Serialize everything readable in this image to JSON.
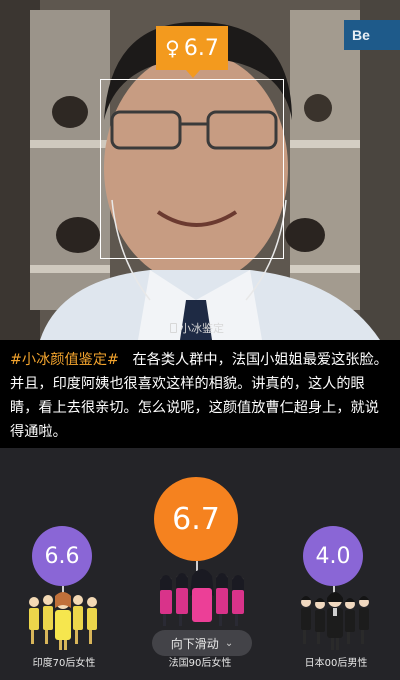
{
  "photo": {
    "score_symbol": "♀",
    "score": "6.7",
    "corner_text": "Be",
    "watermark": "小冰鉴定"
  },
  "caption": {
    "hashtag": "#小冰颜值鉴定#",
    "body": "在各类人群中，法国小姐姐最爱这张脸。并且，印度阿姨也很喜欢这样的相貌。讲真的，这人的眼睛，看上去很亲切。怎么说呢，这颜值放曹仁超身上，就说得通啦。"
  },
  "groups": [
    {
      "score": "6.6",
      "label": "印度70后女性",
      "color": "#8a66d6"
    },
    {
      "score": "6.7",
      "label": "法国90后女性",
      "color": "#f5821f"
    },
    {
      "score": "4.0",
      "label": "日本00后男性",
      "color": "#8a66d6"
    }
  ],
  "scroll_hint": {
    "label": "向下滑动",
    "icon": "chevron-down-icon"
  }
}
